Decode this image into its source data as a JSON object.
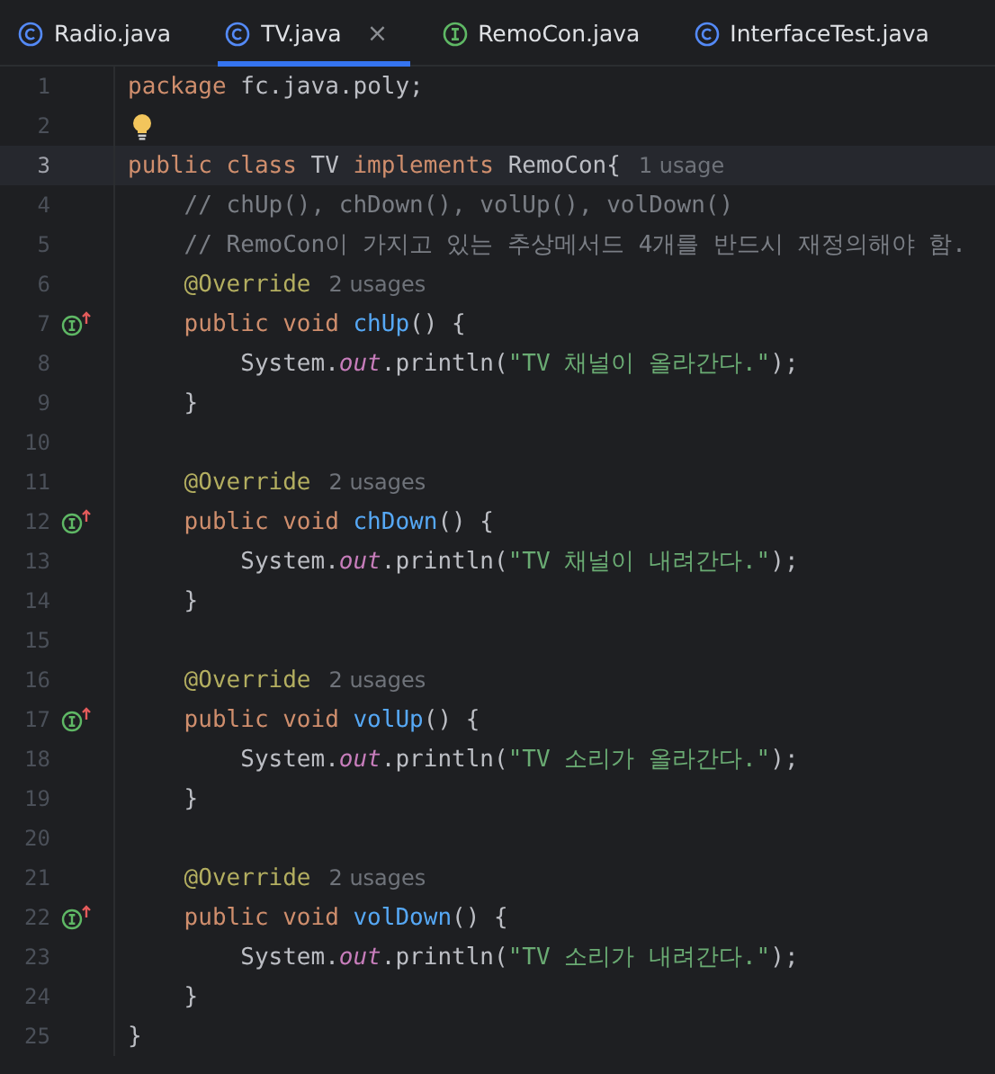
{
  "tabs": [
    {
      "label": "Radio.java",
      "kind": "class",
      "selected": false,
      "closable": false
    },
    {
      "label": "TV.java",
      "kind": "class",
      "selected": true,
      "closable": true
    },
    {
      "label": "RemoCon.java",
      "kind": "interface",
      "selected": false,
      "closable": false
    },
    {
      "label": "InterfaceTest.java",
      "kind": "class",
      "selected": false,
      "closable": false
    }
  ],
  "close_glyph": "×",
  "editor": {
    "lines": [
      {
        "number": "1",
        "current": false,
        "tokens": [
          {
            "kind": "keyword",
            "s": "package "
          },
          {
            "kind": "plain",
            "s": "fc.java.poly;"
          }
        ]
      },
      {
        "number": "2",
        "current": false,
        "bulb": true
      },
      {
        "number": "3",
        "current": true,
        "tokens": [
          {
            "kind": "keyword",
            "s": "public class "
          },
          {
            "kind": "plain",
            "s": "TV "
          },
          {
            "kind": "keyword",
            "s": "implements "
          },
          {
            "kind": "plain",
            "s": "RemoCon{"
          }
        ],
        "hint": "1 usage"
      },
      {
        "number": "4",
        "current": false,
        "tokens": [
          {
            "kind": "comment",
            "s": "    // chUp(), chDown(), volUp(), volDown()"
          }
        ]
      },
      {
        "number": "5",
        "current": false,
        "tokens": [
          {
            "kind": "comment",
            "s": "    // RemoCon이 가지고 있는 추상메서드 4개를 반드시 재정의해야 함."
          }
        ]
      },
      {
        "number": "6",
        "current": false,
        "tokens": [
          {
            "kind": "annotation",
            "s": "    @Override"
          }
        ],
        "hint": "2 usages"
      },
      {
        "number": "7",
        "current": false,
        "implements": true,
        "tokens": [
          {
            "kind": "keyword",
            "s": "    public void "
          },
          {
            "kind": "method",
            "s": "chUp"
          },
          {
            "kind": "plain",
            "s": "() {"
          }
        ]
      },
      {
        "number": "8",
        "current": false,
        "tokens": [
          {
            "kind": "plain",
            "s": "        System."
          },
          {
            "kind": "field",
            "s": "out"
          },
          {
            "kind": "plain",
            "s": ".println("
          },
          {
            "kind": "string",
            "s": "\"TV 채널이 올라간다.\""
          },
          {
            "kind": "plain",
            "s": ");"
          }
        ]
      },
      {
        "number": "9",
        "current": false,
        "tokens": [
          {
            "kind": "plain",
            "s": "    }"
          }
        ]
      },
      {
        "number": "10",
        "current": false
      },
      {
        "number": "11",
        "current": false,
        "tokens": [
          {
            "kind": "annotation",
            "s": "    @Override"
          }
        ],
        "hint": "2 usages"
      },
      {
        "number": "12",
        "current": false,
        "implements": true,
        "tokens": [
          {
            "kind": "keyword",
            "s": "    public void "
          },
          {
            "kind": "method",
            "s": "chDown"
          },
          {
            "kind": "plain",
            "s": "() {"
          }
        ]
      },
      {
        "number": "13",
        "current": false,
        "tokens": [
          {
            "kind": "plain",
            "s": "        System."
          },
          {
            "kind": "field",
            "s": "out"
          },
          {
            "kind": "plain",
            "s": ".println("
          },
          {
            "kind": "string",
            "s": "\"TV 채널이 내려간다.\""
          },
          {
            "kind": "plain",
            "s": ");"
          }
        ]
      },
      {
        "number": "14",
        "current": false,
        "tokens": [
          {
            "kind": "plain",
            "s": "    }"
          }
        ]
      },
      {
        "number": "15",
        "current": false
      },
      {
        "number": "16",
        "current": false,
        "tokens": [
          {
            "kind": "annotation",
            "s": "    @Override"
          }
        ],
        "hint": "2 usages"
      },
      {
        "number": "17",
        "current": false,
        "implements": true,
        "tokens": [
          {
            "kind": "keyword",
            "s": "    public void "
          },
          {
            "kind": "method",
            "s": "volUp"
          },
          {
            "kind": "plain",
            "s": "() {"
          }
        ]
      },
      {
        "number": "18",
        "current": false,
        "tokens": [
          {
            "kind": "plain",
            "s": "        System."
          },
          {
            "kind": "field",
            "s": "out"
          },
          {
            "kind": "plain",
            "s": ".println("
          },
          {
            "kind": "string",
            "s": "\"TV 소리가 올라간다.\""
          },
          {
            "kind": "plain",
            "s": ");"
          }
        ]
      },
      {
        "number": "19",
        "current": false,
        "tokens": [
          {
            "kind": "plain",
            "s": "    }"
          }
        ]
      },
      {
        "number": "20",
        "current": false
      },
      {
        "number": "21",
        "current": false,
        "tokens": [
          {
            "kind": "annotation",
            "s": "    @Override"
          }
        ],
        "hint": "2 usages"
      },
      {
        "number": "22",
        "current": false,
        "implements": true,
        "tokens": [
          {
            "kind": "keyword",
            "s": "    public void "
          },
          {
            "kind": "method",
            "s": "volDown"
          },
          {
            "kind": "plain",
            "s": "() {"
          }
        ]
      },
      {
        "number": "23",
        "current": false,
        "tokens": [
          {
            "kind": "plain",
            "s": "        System."
          },
          {
            "kind": "field",
            "s": "out"
          },
          {
            "kind": "plain",
            "s": ".println("
          },
          {
            "kind": "string",
            "s": "\"TV 소리가 내려간다.\""
          },
          {
            "kind": "plain",
            "s": ");"
          }
        ]
      },
      {
        "number": "24",
        "current": false,
        "tokens": [
          {
            "kind": "plain",
            "s": "    }"
          }
        ]
      },
      {
        "number": "25",
        "current": false,
        "tokens": [
          {
            "kind": "plain",
            "s": "}"
          }
        ]
      }
    ]
  }
}
